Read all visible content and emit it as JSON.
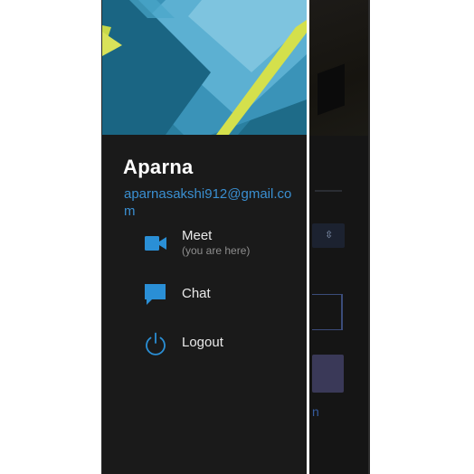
{
  "drawer": {
    "user": {
      "name": "Aparna",
      "email": "aparnasakshi912@gmail.com"
    },
    "menu": [
      {
        "label": "Meet",
        "subtitle": "(you are here)",
        "icon": "video-camera-icon"
      },
      {
        "label": "Chat",
        "icon": "chat-bubble-icon"
      },
      {
        "label": "Logout",
        "icon": "power-icon"
      }
    ],
    "colors": {
      "accent": "#2a8fd6",
      "drawer_background": "#1a1a1a",
      "header_dark": "#1d6a87",
      "header_light": "#63b6d5",
      "header_yellow": "#c8d84a"
    }
  }
}
